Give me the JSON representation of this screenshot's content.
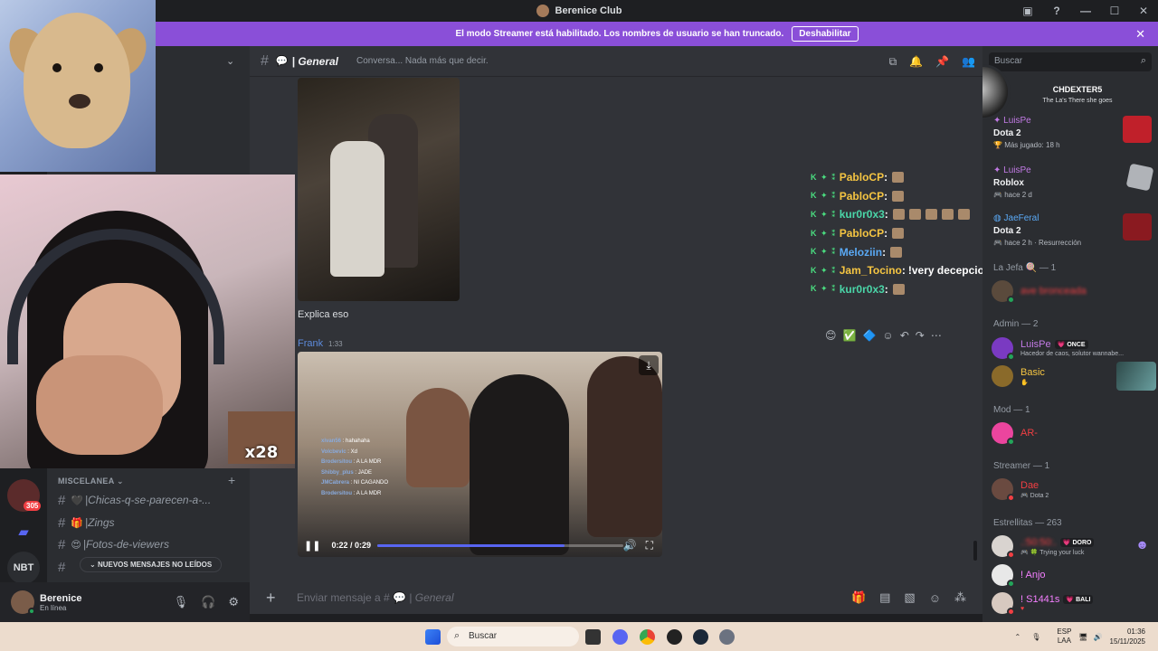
{
  "window": {
    "title": "Berenice Club"
  },
  "banner": {
    "text": "El modo Streamer está habilitado. Los nombres de usuario se han truncado.",
    "button": "Deshabilitar"
  },
  "servers": {
    "badge": "305",
    "item_label": "NBT"
  },
  "channels": {
    "category": "MISCELANEA",
    "items": [
      {
        "emoji": "🖤",
        "name": "Chicas-q-se-parecen-a-..."
      },
      {
        "emoji": "🎁",
        "name": "Zings"
      },
      {
        "emoji": "😍",
        "name": "Fotos-de-viewers"
      }
    ],
    "unread_pill": "NUEVOS MENSAJES NO LEÍDOS"
  },
  "user": {
    "name": "Berenice",
    "status": "En línea"
  },
  "chat": {
    "channel_name": "General",
    "topic": "Conversa... Nada más que decir.",
    "message_text": "Explica eso",
    "author": "Frank",
    "time": "1:33",
    "video": {
      "time": "0:22 / 0:29",
      "progress": 0.76,
      "overlay_chat": [
        {
          "user": "xivan56",
          "text": "hahahaha"
        },
        {
          "user": "Volcbevic",
          "text": "Xd"
        },
        {
          "user": "Brodersitou",
          "text": "A LA MDR"
        },
        {
          "user": "Shibby_plus",
          "text": "JADE"
        },
        {
          "user": "JMCabrera",
          "text": "NI CAGANDO"
        },
        {
          "user": "Brodersitou",
          "text": "A LA MDR"
        }
      ]
    },
    "composer_placeholder_prefix": "Enviar mensaje a #",
    "composer_placeholder_channel": "General"
  },
  "twitch_chat": [
    {
      "user": "PabloCP",
      "color": "#f5c542",
      "text": "",
      "emotes": 1
    },
    {
      "user": "PabloCP",
      "color": "#f5c542",
      "text": "",
      "emotes": 1
    },
    {
      "user": "kur0r0x3",
      "color": "#4ad6a8",
      "text": "",
      "emotes": 5
    },
    {
      "user": "PabloCP",
      "color": "#f5c542",
      "text": "",
      "emotes": 1
    },
    {
      "user": "Meloziin",
      "color": "#5aa9f5",
      "text": "",
      "emotes": 1
    },
    {
      "user": "Jam_Tocino",
      "color": "#f5c542",
      "text": "!very decepcion",
      "emotes": 0
    },
    {
      "user": "kur0r0x3",
      "color": "#4ad6a8",
      "text": "",
      "emotes": 1
    }
  ],
  "members": {
    "search_placeholder": "Buscar",
    "profile": {
      "name": "CHDEXTER5",
      "subtitle": "The La's There she goes"
    },
    "activities": [
      {
        "user": "LuisPe",
        "game": "Dota 2",
        "detail": "Más jugado: 18 h"
      },
      {
        "user": "LuisPe",
        "game": "Roblox",
        "detail": "hace 2 d"
      },
      {
        "user": "JaeFeral",
        "game": "Dota 2",
        "detail": "hace 2 h · Resurrección"
      }
    ],
    "groups": [
      {
        "label": "La Jefa",
        "count": "— 1"
      },
      {
        "label": "Admin",
        "count": "— 2"
      },
      {
        "label": "Mod",
        "count": "— 1"
      },
      {
        "label": "Streamer",
        "count": "— 1"
      },
      {
        "label": "Estrellitas",
        "count": "— 263"
      }
    ],
    "list": [
      {
        "name": "ave bronceada",
        "color": "#f23f43",
        "sub": "",
        "tag": ""
      },
      {
        "name": "LuisPe",
        "color": "#c27ae5",
        "sub": "Hacedor de caos, solutor wannabe...",
        "tag": "ONCE"
      },
      {
        "name": "Basic",
        "color": "#f5c542",
        "sub": "",
        "tag": ""
      },
      {
        "name": "AR-",
        "color": "#f23f43",
        "sub": "",
        "tag": ""
      },
      {
        "name": "Dae",
        "color": "#f23f43",
        "sub": "Dota 2",
        "tag": ""
      },
      {
        "name": "",
        "color": "#f23f43",
        "sub": "Trying your luck",
        "tag": "DORO"
      },
      {
        "name": "! Anjo",
        "color": "#f47fff",
        "sub": "",
        "tag": ""
      },
      {
        "name": "! S1441s",
        "color": "#f47fff",
        "sub": "",
        "tag": "BALI"
      }
    ]
  },
  "webcam": {
    "sub_counter": "x28"
  },
  "taskbar": {
    "search": "Buscar",
    "lang_top": "ESP",
    "lang_bottom": "LAA",
    "time": "01:36",
    "date": "15/11/2025"
  },
  "colors": {
    "banner": "#8a4fd8",
    "accent": "#5865f2",
    "online": "#23a55a",
    "dnd": "#f23f43"
  }
}
